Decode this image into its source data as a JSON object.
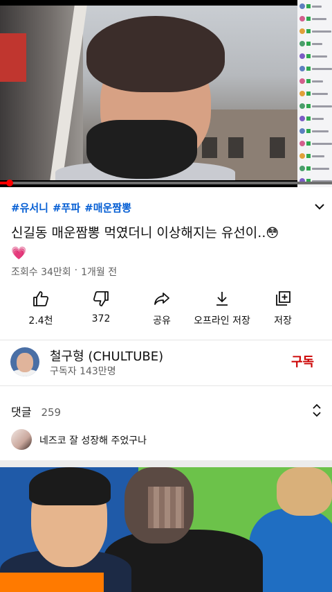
{
  "video": {
    "progress_fraction": 0.03,
    "accent_color": "#ff0000"
  },
  "meta": {
    "hashtags": [
      "#유서니",
      "#푸파",
      "#매운짬뽕"
    ],
    "title": "신길동 매운짬뽕 먹였더니 이상해지는 유선이..",
    "title_emojis": [
      "😳",
      "💗"
    ],
    "views": "조회수 34만회",
    "separator": "·",
    "age": "1개월 전"
  },
  "actions": [
    {
      "icon": "thumb-up-icon",
      "label": "2.4천"
    },
    {
      "icon": "thumb-down-icon",
      "label": "372"
    },
    {
      "icon": "share-icon",
      "label": "공유"
    },
    {
      "icon": "download-icon",
      "label": "오프라인 저장"
    },
    {
      "icon": "save-playlist-icon",
      "label": "저장"
    }
  ],
  "channel": {
    "name": "철구형 (CHULTUBE)",
    "subscribers": "구독자 143만명",
    "subscribe_label": "구독",
    "subscribe_color": "#cc0000"
  },
  "comments": {
    "label": "댓글",
    "count": "259",
    "top_comment": "네즈코 잘 성장해 주었구나"
  }
}
